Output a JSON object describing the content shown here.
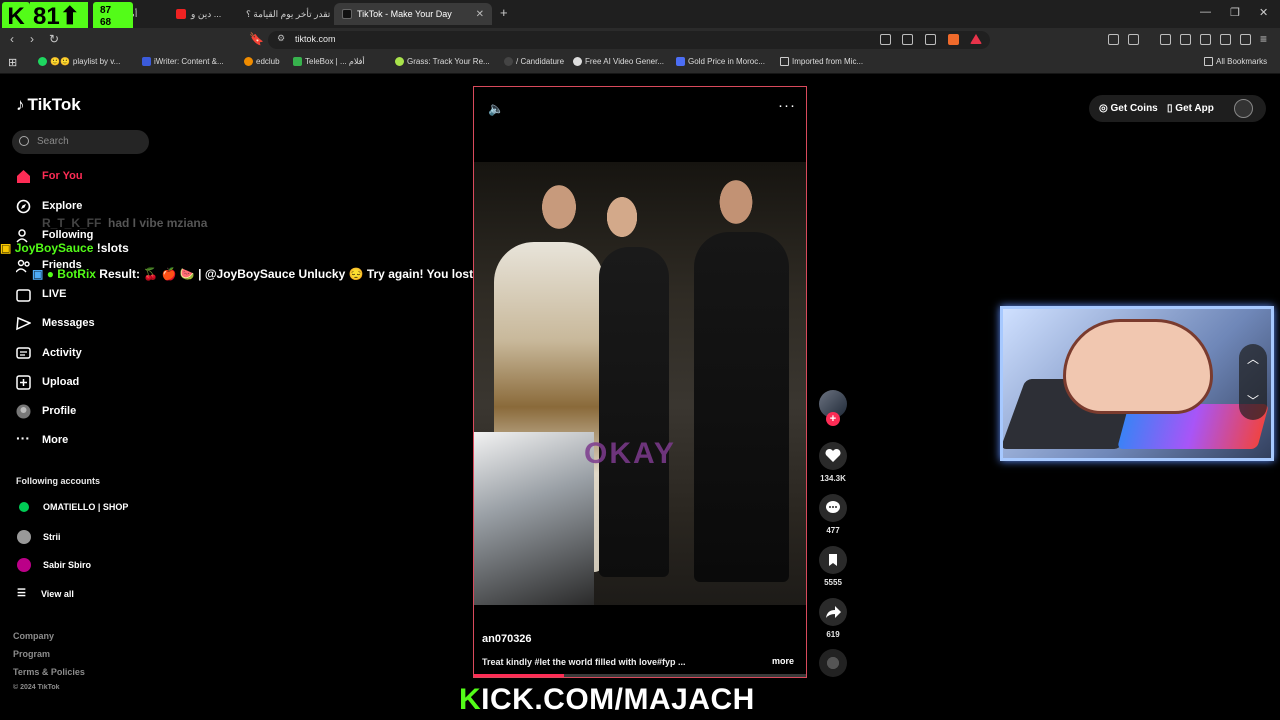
{
  "browser": {
    "tabs": [
      {
        "label": "أصعب",
        "active": false
      },
      {
        "label": "دين و ...",
        "active": false
      },
      {
        "label": "هل تقدر تأخر يوم القيامة ؟",
        "active": false
      },
      {
        "label": "TikTok - Make Your Day",
        "active": true
      }
    ],
    "url": "tiktok.com",
    "bookmarks": [
      {
        "label": "playlist by v...",
        "icon": "spotify-icon"
      },
      {
        "label": "iWriter: Content &...",
        "icon": "iwriter-icon"
      },
      {
        "label": "edclub",
        "icon": "edclub-icon"
      },
      {
        "label": "TeleBox | ... أفلام",
        "icon": "telebox-icon"
      },
      {
        "label": "Grass: Track Your Re...",
        "icon": "grass-icon"
      },
      {
        "label": "/ Candidature",
        "icon": "page-icon"
      },
      {
        "label": "Free AI Video Gener...",
        "icon": "openai-icon"
      },
      {
        "label": "Gold Price in Moroc...",
        "icon": "gp-icon"
      },
      {
        "label": "Imported from Mic...",
        "icon": "folder-icon"
      },
      {
        "label": "All Bookmarks",
        "icon": "folder-icon"
      }
    ]
  },
  "stream": {
    "viewers": "81",
    "followers_top": "87",
    "followers_bottom": "68",
    "kick_url_k": "K",
    "kick_url_rest": "ICK.COM/MAJACH",
    "chat": [
      {
        "user": "",
        "text": "had I vibe mziana",
        "faded": true
      },
      {
        "user": "JoyBoySauce",
        "text": "!slots"
      },
      {
        "user": "BotRix",
        "text": "Result: 🍒 🍎 🍉 | @JoyBoySauce Unlucky 😔 Try again! You lost 50 points."
      }
    ]
  },
  "tiktok": {
    "logo": "TikTok",
    "search_placeholder": "Search",
    "nav": [
      {
        "label": "For You",
        "icon": "home-icon",
        "active": true
      },
      {
        "label": "Explore",
        "icon": "compass-icon"
      },
      {
        "label": "Following",
        "icon": "following-icon"
      },
      {
        "label": "Friends",
        "icon": "friends-icon"
      },
      {
        "label": "LIVE",
        "icon": "live-icon"
      },
      {
        "label": "Messages",
        "icon": "messages-icon"
      },
      {
        "label": "Activity",
        "icon": "activity-icon"
      },
      {
        "label": "Upload",
        "icon": "upload-icon"
      },
      {
        "label": "Profile",
        "icon": "profile-icon"
      },
      {
        "label": "More",
        "icon": "more-icon"
      }
    ],
    "following_title": "Following accounts",
    "following_accounts": [
      "OMATIELLO | SHOP",
      "Strii",
      "Sabir Sbiro"
    ],
    "view_all": "View all",
    "footer": [
      "Company",
      "Program",
      "Terms & Policies",
      "© 2024 TikTok"
    ],
    "get_coins": "Get Coins",
    "get_app": "Get App",
    "video": {
      "author": "an070326",
      "caption": "Treat kindly #let the world filled with love#fyp ...",
      "more": "more",
      "overlay_text": "OKAY",
      "progress": 0.27,
      "likes": "134.3K",
      "comments": "477",
      "saves": "5555",
      "shares": "619"
    }
  },
  "colors": {
    "accent": "#fe2c55",
    "kick_green": "#53fc18",
    "video_border": "#d94a5c"
  }
}
